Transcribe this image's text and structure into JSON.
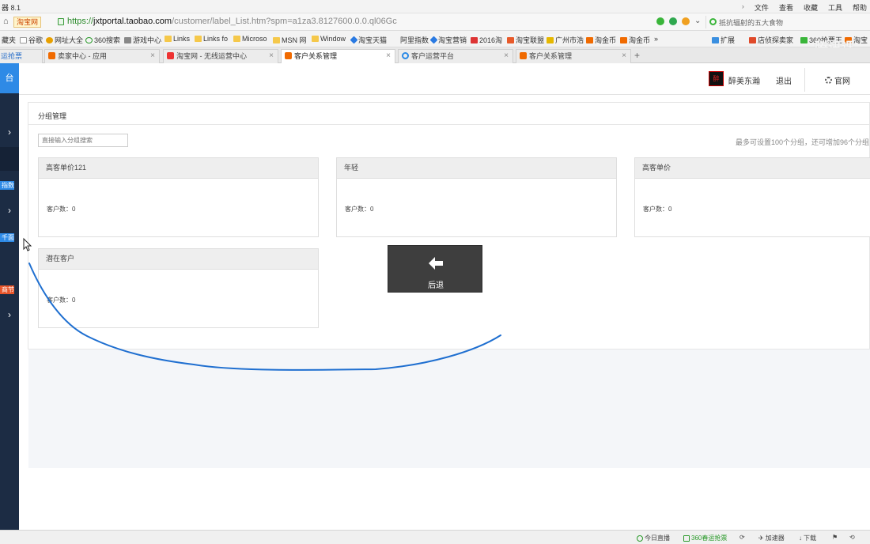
{
  "browser": {
    "title": "器 8.1",
    "menu": [
      "文件",
      "查看",
      "收藏",
      "工具",
      "帮助"
    ],
    "site_badge": "淘宝网",
    "url_scheme": "https://",
    "url_host": "jxtportal.taobao.com",
    "url_path": "/customer/label_List.htm?spm=a1za3.8127600.0.0.ql06Gc",
    "search_text": "抵抗辐射的五大食物",
    "bookmarks": [
      "藏夹",
      "谷歌",
      "网址大全",
      "360搜索",
      "游戏中心",
      "Links",
      "Links fo",
      "Microso",
      "MSN 网",
      "Window",
      "淘宝天猫",
      "阿里指数",
      "淘宝营销",
      "2016淘",
      "淘宝联盟",
      "广州市浩",
      "淘金币",
      "淘金币",
      "»",
      "扩展",
      "店侦探卖家",
      "360抢票王",
      "淘宝"
    ],
    "tabs": [
      {
        "label": "运抢票",
        "active": false
      },
      {
        "label": "卖家中心 - 应用",
        "active": false
      },
      {
        "label": "淘宝网 - 无线运营中心",
        "active": false
      },
      {
        "label": "客户关系管理",
        "active": true
      },
      {
        "label": "客户运营平台",
        "active": false
      },
      {
        "label": "客户关系管理",
        "active": false
      }
    ],
    "tab_add": "+",
    "watermark": "腾讯课"
  },
  "sidebar": {
    "top_icon": "台",
    "tags": [
      "指数",
      "千面",
      "商节"
    ]
  },
  "header": {
    "shop_logo": "醉",
    "shop_name": "醉美东瀚",
    "logout": "退出",
    "official_site": "官网"
  },
  "panel": {
    "title": "分组管理",
    "search_placeholder": "直接输入分组搜索",
    "limit_note": "最多可设置100个分组，还可增加96个分组",
    "groups": [
      {
        "name": "高客单价121",
        "count_label": "客户数：0"
      },
      {
        "name": "年轻",
        "count_label": "客户数：0"
      },
      {
        "name": "高客单价",
        "count_label": "客户数：0"
      },
      {
        "name": "潜在客户",
        "count_label": "客户数：0"
      }
    ]
  },
  "overlay": {
    "back_label": "后退"
  },
  "statusbar": {
    "items": [
      "今日直播",
      "360春运抢票",
      "加速器",
      "下载"
    ]
  },
  "colors": {
    "sidebar_bg": "#1c2c44",
    "sidebar_accent": "#2e8ae6",
    "annotation_stroke": "#1f6fd0",
    "overlay_bg": "#3e3e3e"
  },
  "icons": [
    "home-icon",
    "lock-icon",
    "search-icon",
    "gear-icon",
    "back-arrow-icon",
    "close-icon",
    "chevron-right-icon",
    "cursor-icon"
  ]
}
